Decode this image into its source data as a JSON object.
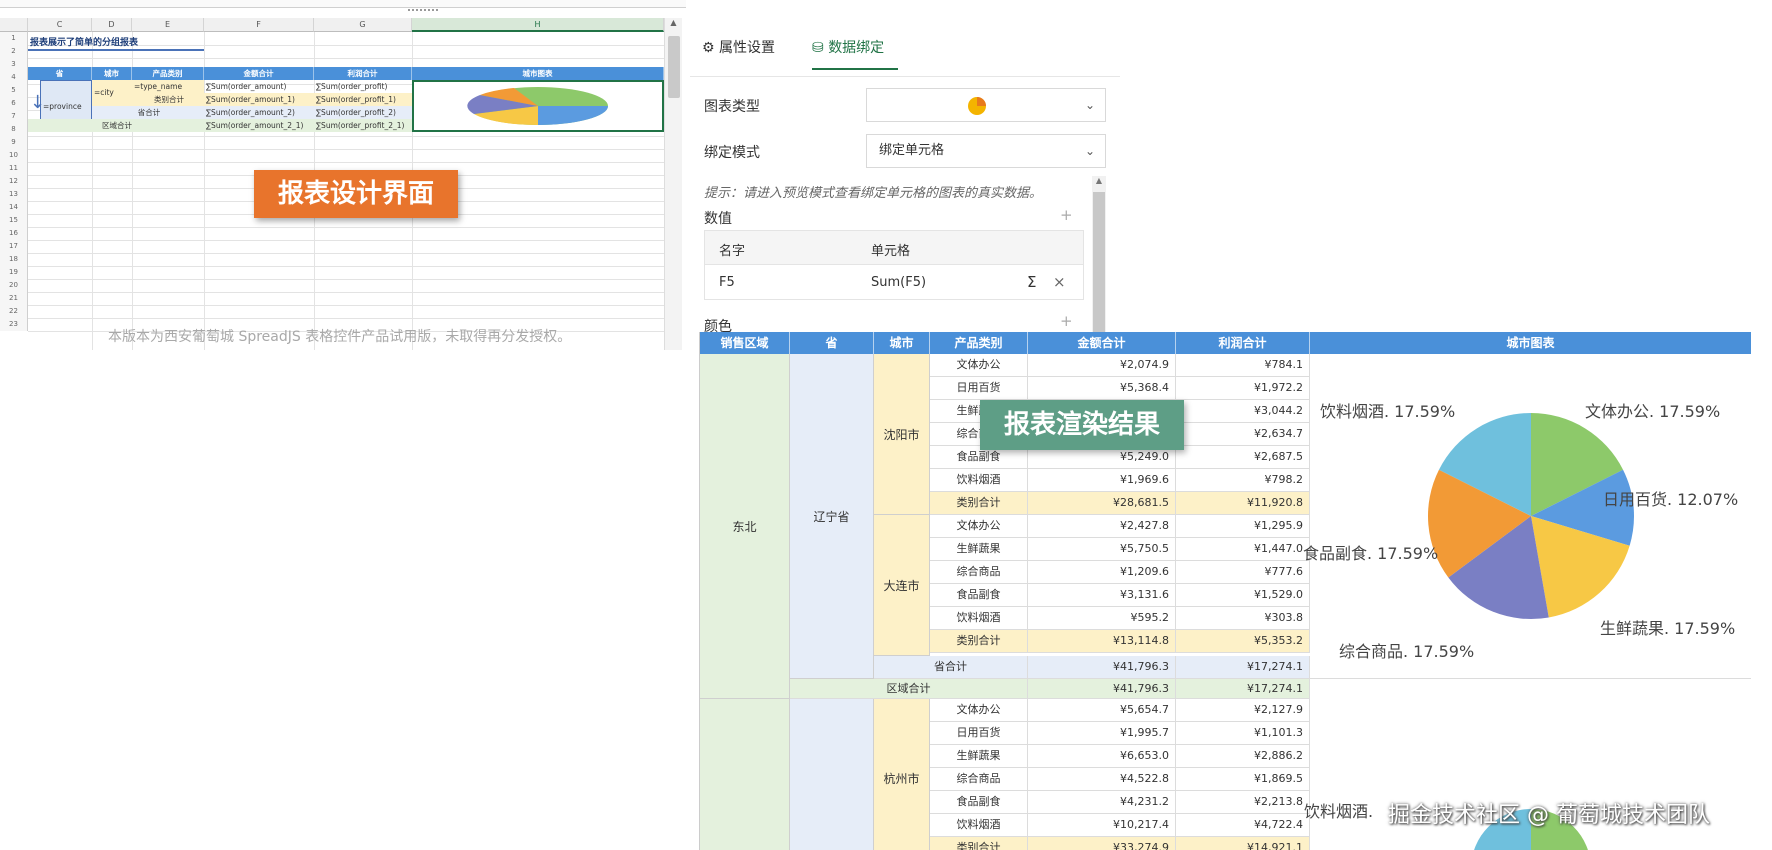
{
  "designer": {
    "columns": [
      "C",
      "D",
      "E",
      "F",
      "G",
      "H"
    ],
    "rows": [
      "1",
      "2",
      "3",
      "4",
      "5",
      "6",
      "7",
      "8",
      "9",
      "10",
      "11",
      "12",
      "13",
      "14",
      "15",
      "16",
      "17",
      "18",
      "19",
      "20",
      "21",
      "22",
      "23"
    ],
    "title": "报表展示了简单的分组报表",
    "headers": [
      "省",
      "城市",
      "产品类别",
      "金额合计",
      "利润合计",
      "城市图表"
    ],
    "cells": {
      "province": "=province",
      "city": "=city",
      "type_name": "=type_name",
      "sum_amount": "∑Sum(order_amount)",
      "sum_profit": "∑Sum(order_profit)",
      "subtotal_label": "类别合计",
      "sum_amount_1": "∑Sum(order_amount_1)",
      "sum_profit_1": "∑Sum(order_profit_1)",
      "province_total_label": "省合计",
      "sum_amount_2": "∑Sum(order_amount_2)",
      "sum_profit_2": "∑Sum(order_profit_2)",
      "region_total_label": "区域合计",
      "sum_amount_2_1": "∑Sum(order_amount_2_1)",
      "sum_profit_2_1": "∑Sum(order_profit_2_1)"
    },
    "watermark": "本版本为西安葡萄城 SpreadJS 表格控件产品试用版，未取得再分发授权。",
    "badge": "报表设计界面"
  },
  "panel": {
    "tabs": [
      {
        "label": "属性设置",
        "icon": "gear-icon",
        "active": false
      },
      {
        "label": "数据绑定",
        "icon": "database-icon",
        "active": true
      }
    ],
    "chart_type_label": "图表类型",
    "chart_type_icon": "pie-chart-icon",
    "bind_mode_label": "绑定模式",
    "bind_mode_value": "绑定单元格",
    "hint": "提示：请进入预览模式查看绑定单元格的图表的真实数据。",
    "values_label": "数值",
    "table_headers": [
      "名字",
      "单元格"
    ],
    "table_row": {
      "name": "F5",
      "cell": "Sum(F5)"
    },
    "color_label": "颜色",
    "accent": "#217346"
  },
  "report": {
    "headers": [
      "销售区域",
      "省",
      "城市",
      "产品类别",
      "金额合计",
      "利润合计",
      "城市图表"
    ],
    "region_1": "东北",
    "province_1": "辽宁省",
    "city_1": "沈阳市",
    "city_2": "大连市",
    "city_3": "杭州市",
    "shenyang": [
      {
        "type": "文体办公",
        "amount": "¥2,074.9",
        "profit": "¥784.1"
      },
      {
        "type": "日用百货",
        "amount": "¥5,368.4",
        "profit": "¥1,972.2"
      },
      {
        "type": "生鲜蔬果",
        "amount": "",
        "profit": "¥3,044.2"
      },
      {
        "type": "综合商品",
        "amount": "",
        "profit": "¥2,634.7"
      },
      {
        "type": "食品副食",
        "amount": "¥5,249.0",
        "profit": "¥2,687.5"
      },
      {
        "type": "饮料烟酒",
        "amount": "¥1,969.6",
        "profit": "¥798.2"
      }
    ],
    "shenyang_sub": {
      "type": "类别合计",
      "amount": "¥28,681.5",
      "profit": "¥11,920.8"
    },
    "dalian": [
      {
        "type": "文体办公",
        "amount": "¥2,427.8",
        "profit": "¥1,295.9"
      },
      {
        "type": "生鲜蔬果",
        "amount": "¥5,750.5",
        "profit": "¥1,447.0"
      },
      {
        "type": "综合商品",
        "amount": "¥1,209.6",
        "profit": "¥777.6"
      },
      {
        "type": "食品副食",
        "amount": "¥3,131.6",
        "profit": "¥1,529.0"
      },
      {
        "type": "饮料烟酒",
        "amount": "¥595.2",
        "profit": "¥303.8"
      }
    ],
    "dalian_sub": {
      "type": "类别合计",
      "amount": "¥13,114.8",
      "profit": "¥5,353.2"
    },
    "province_total": {
      "label": "省合计",
      "amount": "¥41,796.3",
      "profit": "¥17,274.1"
    },
    "region_total": {
      "label": "区域合计",
      "amount": "¥41,796.3",
      "profit": "¥17,274.1"
    },
    "hangzhou": [
      {
        "type": "文体办公",
        "amount": "¥5,654.7",
        "profit": "¥2,127.9"
      },
      {
        "type": "日用百货",
        "amount": "¥1,995.7",
        "profit": "¥1,101.3"
      },
      {
        "type": "生鲜蔬果",
        "amount": "¥6,653.0",
        "profit": "¥2,886.2"
      },
      {
        "type": "综合商品",
        "amount": "¥4,522.8",
        "profit": "¥1,869.5"
      },
      {
        "type": "食品副食",
        "amount": "¥4,231.2",
        "profit": "¥2,213.8"
      },
      {
        "type": "饮料烟酒",
        "amount": "¥10,217.4",
        "profit": "¥4,722.4"
      }
    ],
    "hangzhou_sub": {
      "type": "类别合计",
      "amount": "¥33,274.9",
      "profit": "¥14,921.1"
    },
    "badge": "报表渲染结果",
    "pie_label_hangzhou": "饮料烟酒."
  },
  "credit": "掘金技术社区 @ 葡萄城技术团队",
  "chart_data": {
    "type": "pie",
    "title": "",
    "categories": [
      "文体办公",
      "日用百货",
      "生鲜蔬果",
      "综合商品",
      "食品副食",
      "饮料烟酒"
    ],
    "values": [
      17.59,
      12.07,
      17.59,
      17.59,
      17.59,
      17.59
    ],
    "labels": [
      "文体办公. 17.59%",
      "日用百货. 12.07%",
      "生鲜蔬果. 17.59%",
      "综合商品. 17.59%",
      "食品副食. 17.59%",
      "饮料烟酒. 17.59%"
    ],
    "colors": [
      "#8dc96a",
      "#5b9be0",
      "#f7c845",
      "#7a7fc4",
      "#f29a36",
      "#6fc0dd"
    ]
  }
}
